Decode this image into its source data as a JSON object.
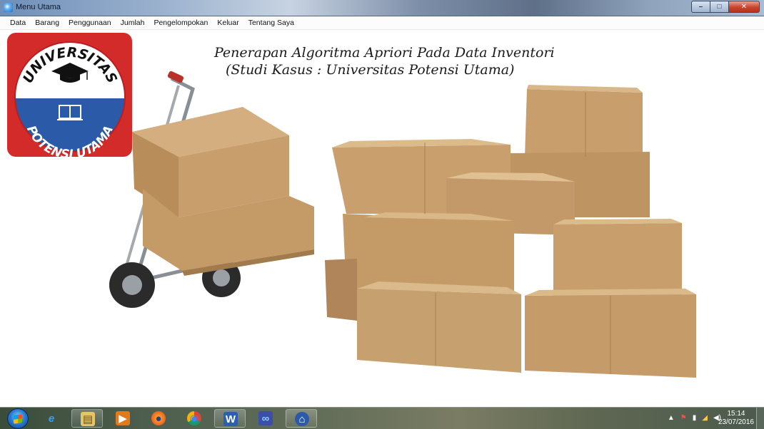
{
  "window": {
    "title": "Menu Utama",
    "controls": {
      "minimize": "–",
      "maximize": "□",
      "close": "✕"
    }
  },
  "menu": {
    "items": [
      "Data",
      "Barang",
      "Penggunaan",
      "Jumlah",
      "Pengelompokan",
      "Keluar",
      "Tentang Saya"
    ]
  },
  "header": {
    "line1": "Penerapan Algoritma Apriori Pada Data Inventori",
    "line2": "(Studi Kasus : Universitas Potensi Utama)"
  },
  "logo": {
    "top_text": "UNIVERSITAS",
    "bottom_text": "POTENSI UTAMA",
    "colors": {
      "outer": "#d32a2a",
      "top": "#ffffff",
      "bottom": "#2a5aa8"
    }
  },
  "taskbar": {
    "apps": [
      {
        "name": "internet-explorer-icon",
        "glyph": "e"
      },
      {
        "name": "file-explorer-icon",
        "glyph": "▤"
      },
      {
        "name": "media-player-icon",
        "glyph": "▶"
      },
      {
        "name": "firefox-icon",
        "glyph": "●"
      },
      {
        "name": "chrome-icon",
        "glyph": "◉"
      },
      {
        "name": "word-icon",
        "glyph": "W"
      },
      {
        "name": "app-infinity-icon",
        "glyph": "∞"
      },
      {
        "name": "app-university-icon",
        "glyph": "⌂"
      }
    ],
    "tray": {
      "chevron": "▲",
      "flag": "⚑",
      "battery": "▮",
      "network": "◢",
      "volume": "◀)"
    },
    "clock": {
      "time": "15:14",
      "date": "23/07/2016"
    }
  }
}
